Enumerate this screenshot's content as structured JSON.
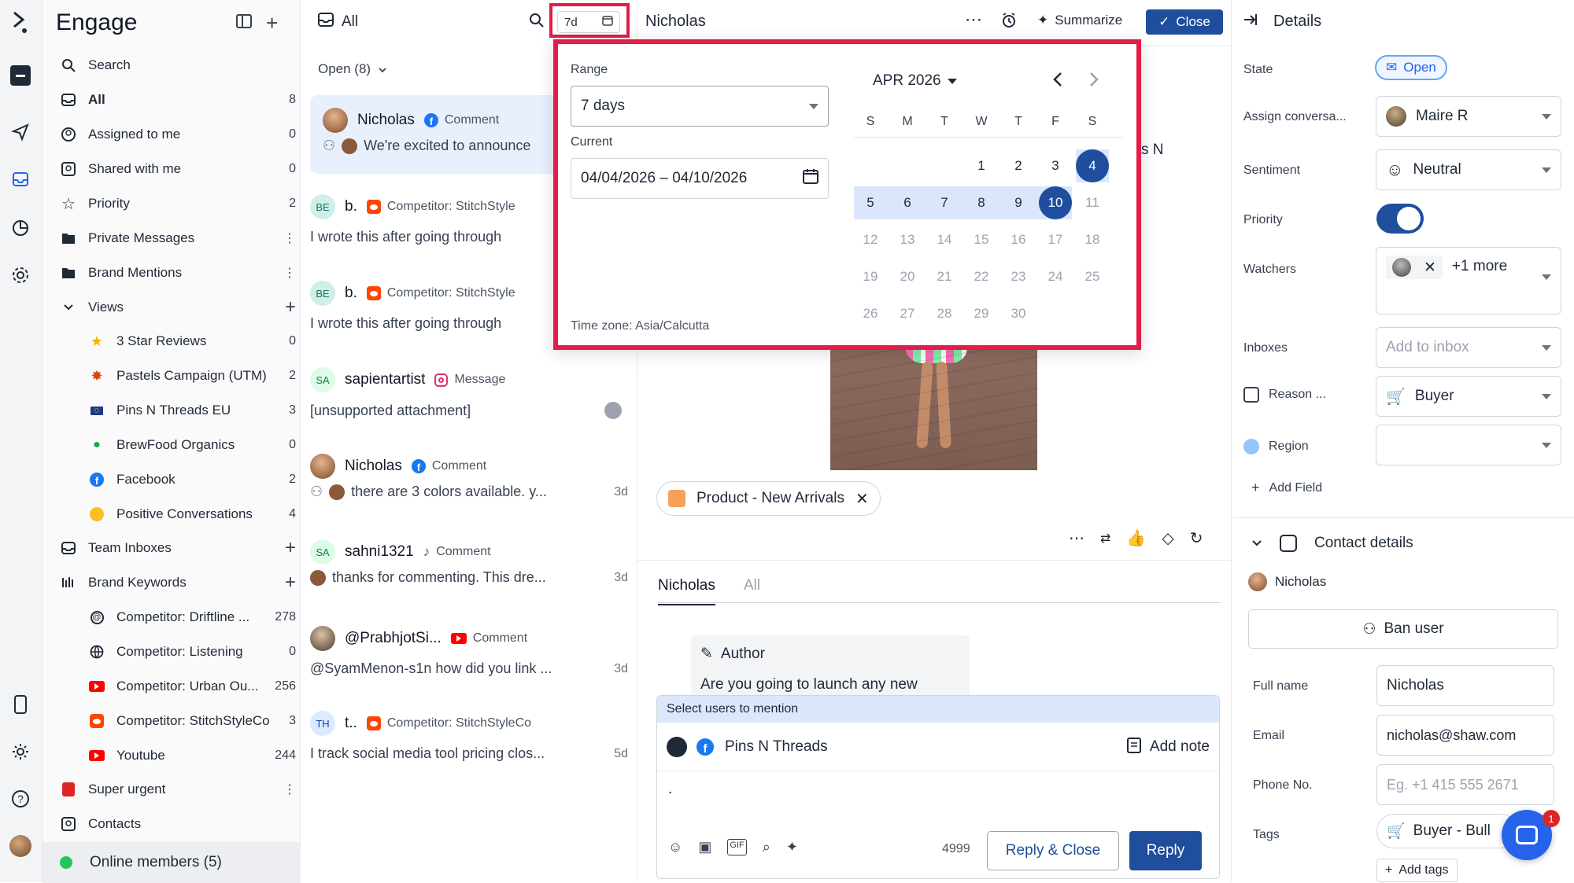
{
  "app": {
    "title": "Engage"
  },
  "rail": {
    "icons": [
      "logo-icon",
      "inbox-tray-icon",
      "send-icon",
      "inbox-icon",
      "analytics-icon",
      "settings-icon",
      "mobile-icon",
      "brightness-icon",
      "help-icon",
      "user-avatar"
    ]
  },
  "nav": {
    "search": "Search",
    "items": [
      {
        "label": "All",
        "count": "8"
      },
      {
        "label": "Assigned to me",
        "count": "0"
      },
      {
        "label": "Shared with me",
        "count": "0"
      },
      {
        "label": "Priority",
        "count": "2"
      },
      {
        "label": "Private Messages"
      },
      {
        "label": "Brand Mentions"
      },
      {
        "label": "Views"
      }
    ],
    "views": [
      {
        "label": "3 Star Reviews",
        "count": "0"
      },
      {
        "label": "Pastels Campaign (UTM)",
        "count": "2"
      },
      {
        "label": "Pins N Threads EU",
        "count": "3"
      },
      {
        "label": "BrewFood Organics",
        "count": "0"
      },
      {
        "label": "Facebook",
        "count": "2"
      },
      {
        "label": "Positive Conversations",
        "count": "4"
      }
    ],
    "team_inboxes": "Team Inboxes",
    "brand_keywords": "Brand Keywords",
    "keywords": [
      {
        "label": "Competitor: Driftline ...",
        "count": "278"
      },
      {
        "label": "Competitor: Listening",
        "count": "0"
      },
      {
        "label": "Competitor: Urban Ou...",
        "count": "256"
      },
      {
        "label": "Competitor: StitchStyleCo",
        "count": "3"
      },
      {
        "label": "Youtube",
        "count": "244"
      }
    ],
    "super_urgent": "Super urgent",
    "contacts": "Contacts",
    "online": "Online members (5)"
  },
  "list": {
    "filter": "All",
    "date_chip": "7d",
    "open_label": "Open (8)",
    "items": [
      {
        "name": "Nicholas",
        "type": "Comment",
        "preview": "We're excited to announce",
        "age": "",
        "initials": ""
      },
      {
        "name": "b.",
        "type": "Competitor: StitchStyle",
        "preview": "I wrote this after going through",
        "age": "",
        "initials": "BE"
      },
      {
        "name": "b.",
        "type": "Competitor: StitchStyle",
        "preview": "I wrote this after going through",
        "age": "",
        "initials": "BE"
      },
      {
        "name": "sapientartist",
        "type": "Message",
        "preview": "[unsupported attachment]",
        "age": "",
        "initials": "SA"
      },
      {
        "name": "Nicholas",
        "type": "Comment",
        "preview": "there are 3 colors available. y...",
        "age": "3d",
        "initials": ""
      },
      {
        "name": "sahni1321",
        "type": "Comment",
        "preview": "thanks for commenting. This dre...",
        "age": "3d",
        "initials": "SA"
      },
      {
        "name": "@PrabhjotSi...",
        "type": "Comment",
        "preview": "@SyamMenon-s1n how did you link ...",
        "age": "3d",
        "initials": ""
      },
      {
        "name": "t..",
        "type": "Competitor: StitchStyleCo",
        "preview": "I track social media tool pricing clos...",
        "age": "5d",
        "initials": "TH"
      }
    ]
  },
  "conversation": {
    "name": "Nicholas",
    "summarize": "Summarize",
    "close": "Close",
    "partial_text": "s N",
    "tag": "Product - New Arrivals",
    "tabs": [
      "Nicholas",
      "All"
    ],
    "author_label": "Author",
    "author_text": "Are you going to launch any new",
    "mention_bar": "Select users to mention",
    "account": "Pins N Threads",
    "add_note": "Add note",
    "composer_text": ".",
    "char_count": "4999",
    "reply_close": "Reply & Close",
    "reply": "Reply"
  },
  "datepicker": {
    "range_label": "Range",
    "range_value": "7 days",
    "current_label": "Current",
    "current_value": "04/04/2026 – 04/10/2026",
    "timezone": "Time zone: Asia/Calcutta",
    "month": "APR 2026",
    "weekdays": [
      "S",
      "M",
      "T",
      "W",
      "T",
      "F",
      "S"
    ],
    "weeks": [
      [
        "",
        "",
        "",
        "1",
        "2",
        "3",
        "4"
      ],
      [
        "5",
        "6",
        "7",
        "8",
        "9",
        "10",
        "11"
      ],
      [
        "12",
        "13",
        "14",
        "15",
        "16",
        "17",
        "18"
      ],
      [
        "19",
        "20",
        "21",
        "22",
        "23",
        "24",
        "25"
      ],
      [
        "26",
        "27",
        "28",
        "29",
        "30",
        "",
        ""
      ]
    ],
    "selected_start": "4",
    "selected_end": "10"
  },
  "details": {
    "title": "Details",
    "fields": [
      {
        "label": "State",
        "value": "Open"
      },
      {
        "label": "Assign conversa...",
        "value": "Maire R"
      },
      {
        "label": "Sentiment",
        "value": "Neutral"
      },
      {
        "label": "Priority",
        "value": "on"
      },
      {
        "label": "Watchers",
        "value": "+1 more"
      },
      {
        "label": "Inboxes",
        "value": "Add to inbox"
      },
      {
        "label": "Reason ...",
        "value": "Buyer"
      },
      {
        "label": "Region",
        "value": ""
      }
    ],
    "add_field": "Add Field",
    "contact_title": "Contact details",
    "contact_name": "Nicholas",
    "ban_user": "Ban user",
    "full_name_label": "Full name",
    "full_name": "Nicholas",
    "email_label": "Email",
    "email": "nicholas@shaw.com",
    "phone_label": "Phone No.",
    "phone_placeholder": "Eg. +1 415 555 2671",
    "tags_label": "Tags",
    "tag_value": "Buyer - Bull",
    "add_tags": "Add tags",
    "chat_badge": "1"
  },
  "colors": {
    "accent": "#1e4e9c",
    "highlight": "#e11d48",
    "range_fill": "#dbe6fb"
  }
}
